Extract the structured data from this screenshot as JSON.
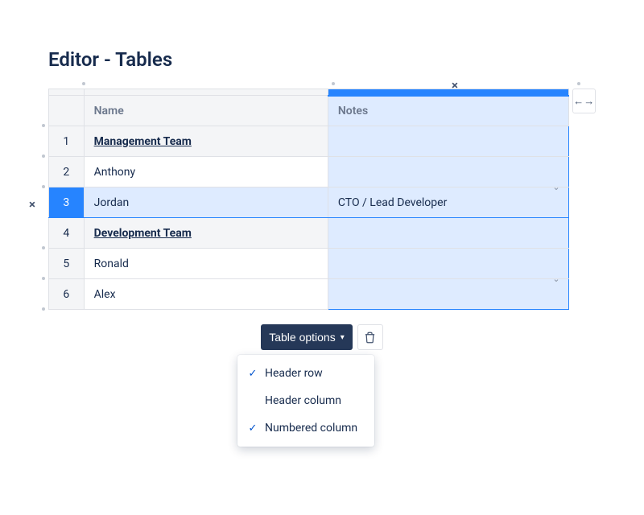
{
  "title": "Editor - Tables",
  "columns": {
    "name": "Name",
    "notes": "Notes"
  },
  "rows": [
    {
      "n": "1",
      "name": "Management Team",
      "notes": "",
      "group": true
    },
    {
      "n": "2",
      "name": "Anthony",
      "notes": ""
    },
    {
      "n": "3",
      "name": "Jordan",
      "notes": "CTO / Lead Developer",
      "active": true
    },
    {
      "n": "4",
      "name": "Development Team",
      "notes": "",
      "group": true
    },
    {
      "n": "5",
      "name": "Ronald",
      "notes": ""
    },
    {
      "n": "6",
      "name": "Alex",
      "notes": ""
    }
  ],
  "toolbar": {
    "table_options": "Table options"
  },
  "menu": {
    "header_row": "Header row",
    "header_column": "Header column",
    "numbered_column": "Numbered column"
  }
}
